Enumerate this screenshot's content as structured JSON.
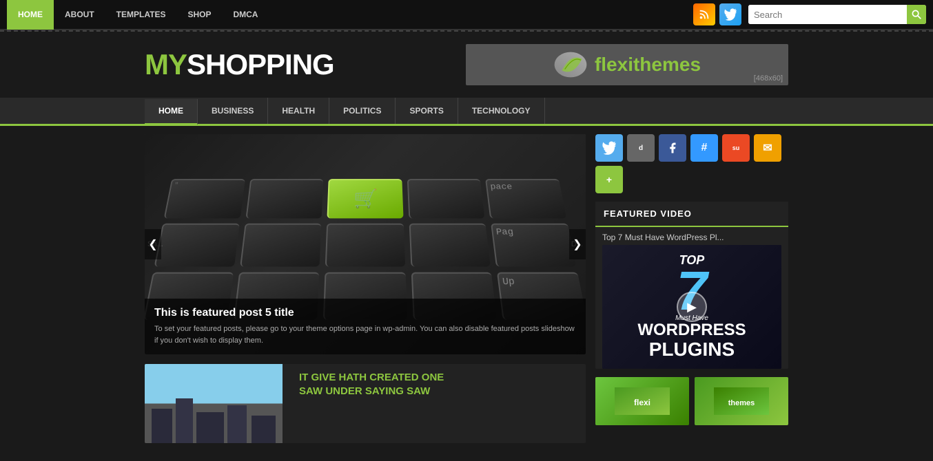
{
  "topNav": {
    "links": [
      {
        "label": "HOME",
        "active": true
      },
      {
        "label": "ABOUT",
        "active": false
      },
      {
        "label": "TEMPLATES",
        "active": false
      },
      {
        "label": "SHOP",
        "active": false
      },
      {
        "label": "DMCA",
        "active": false
      }
    ]
  },
  "search": {
    "placeholder": "Search",
    "label": "Search"
  },
  "header": {
    "logo_my": "MY",
    "logo_shopping": "SHOPPING",
    "banner_text": "flexithemes",
    "banner_size": "[468x60]"
  },
  "secondNav": {
    "links": [
      {
        "label": "HOME",
        "active": true
      },
      {
        "label": "BUSINESS",
        "active": false
      },
      {
        "label": "HEALTH",
        "active": false
      },
      {
        "label": "POLITICS",
        "active": false
      },
      {
        "label": "SPORTS",
        "active": false
      },
      {
        "label": "TECHNOLOGY",
        "active": false
      }
    ]
  },
  "slideshow": {
    "title": "This is featured post 5 title",
    "desc": "To set your featured posts, please go to your theme options page in wp-admin. You can also disable featured posts slideshow if you don't wish to display them."
  },
  "post": {
    "title_line1": "IT GIVE HATH CREATED ONE",
    "title_line2": "SAW UNDER SAYING SAW"
  },
  "sidebar": {
    "socialIcons": [
      {
        "label": "t",
        "name": "twitter"
      },
      {
        "label": "d",
        "name": "digg"
      },
      {
        "label": "f",
        "name": "facebook"
      },
      {
        "label": "#",
        "name": "delicious"
      },
      {
        "label": "su",
        "name": "stumbleupon"
      },
      {
        "label": "✉",
        "name": "mail"
      },
      {
        "label": "+",
        "name": "plus"
      }
    ],
    "featuredVideoLabel": "FEATURED VIDEO",
    "videoTitle": "Top 7 Must Have WordPress Pl...",
    "videoTopText": "TOP",
    "videoNumber": "7",
    "videoMustHave": "Must Have",
    "videoWordpress": "WORDPRESS",
    "videoPlugins": "PLUGINS"
  }
}
